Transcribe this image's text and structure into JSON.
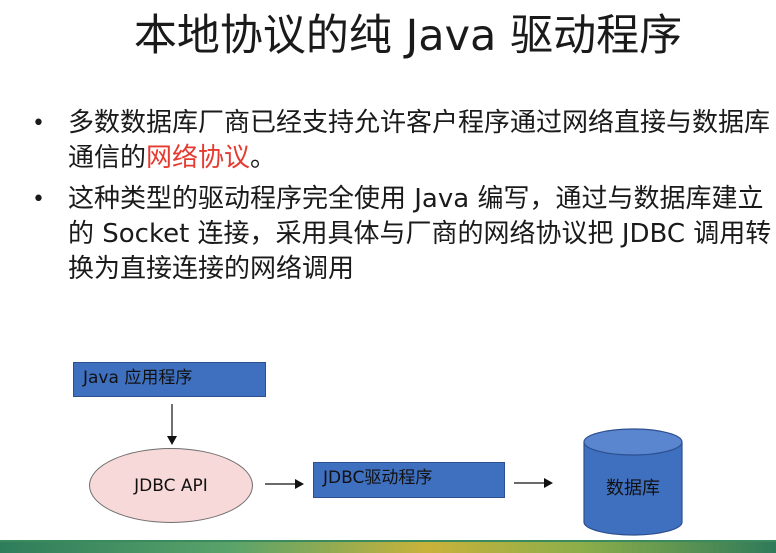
{
  "slide": {
    "title": "本地协议的纯 Java 驱动程序",
    "bullets": [
      {
        "text_before": "多数数据库厂商已经支持允许客户程序通过网络直接与数据库通信的",
        "highlight": "网络协议",
        "text_after": "。"
      },
      {
        "text_before": "这种类型的驱动程序完全使用 Java 编写，通过与数据库建立的 Socket 连接，采用具体与厂商的网络协议把 JDBC 调用转换为直接连接的网络调用",
        "highlight": "",
        "text_after": ""
      }
    ],
    "bullet_symbol": "•"
  },
  "diagram": {
    "java_app_label": "Java 应用程序",
    "jdbc_api_label": "JDBC API",
    "jdbc_driver_label": "JDBC驱动程序",
    "database_label": "数据库"
  },
  "colors": {
    "box_fill": "#3f6fbf",
    "ellipse_fill": "#f8d9d9",
    "highlight_text": "#e53a2f"
  }
}
